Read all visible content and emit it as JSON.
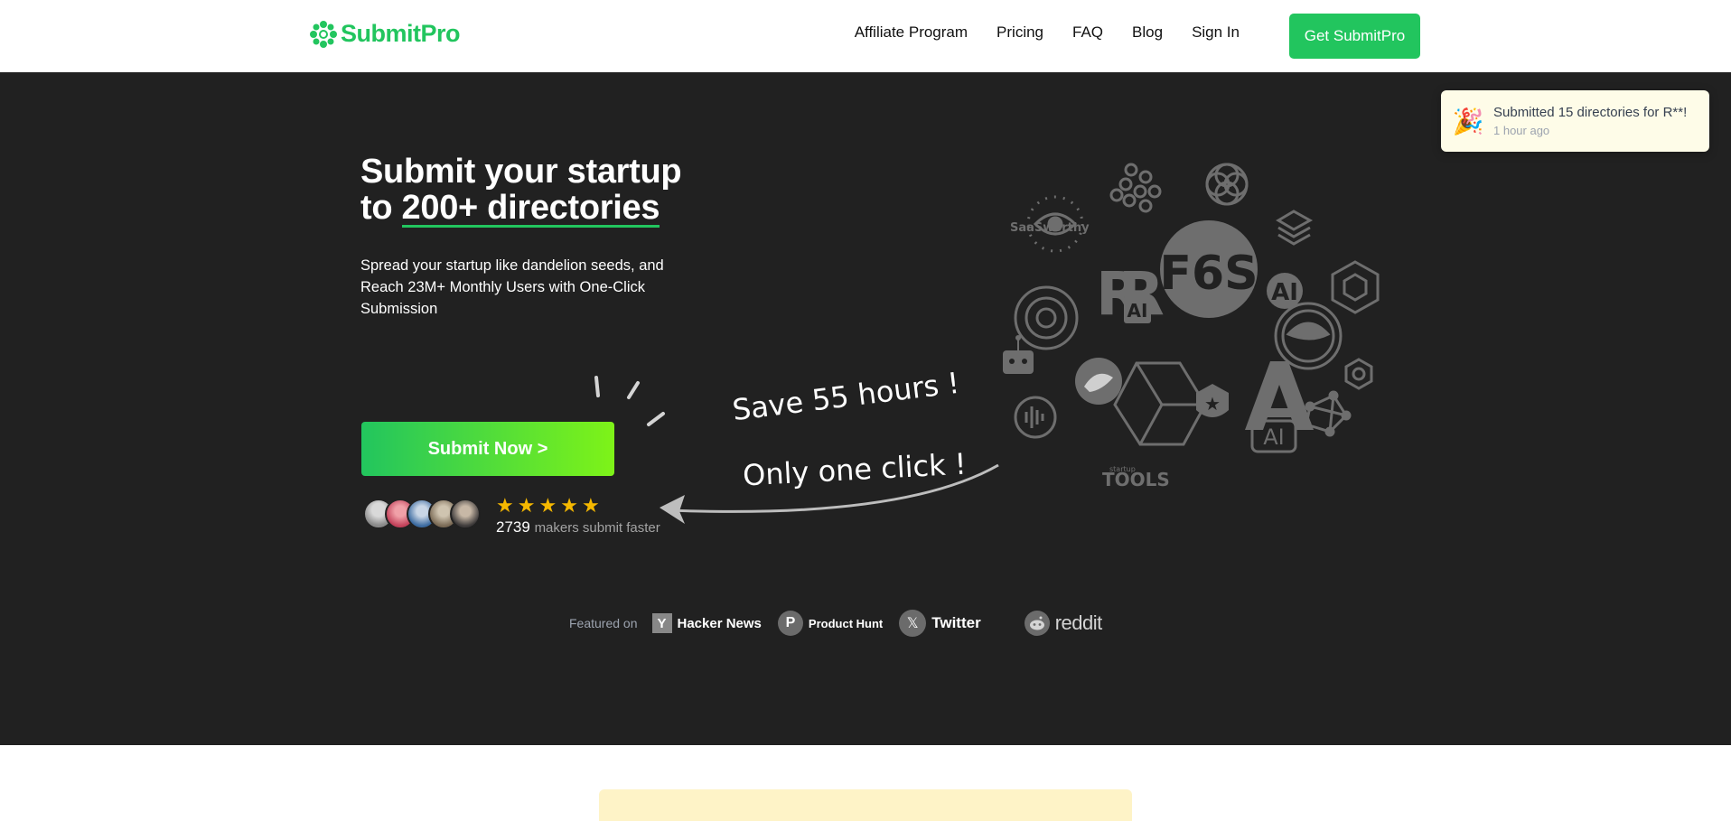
{
  "nav": {
    "logo_text": "SubmitPro",
    "links": [
      "Affiliate Program",
      "Pricing",
      "FAQ",
      "Blog",
      "Sign In"
    ],
    "cta_label": "Get SubmitPro"
  },
  "hero": {
    "headline_line1": "Submit your startup",
    "headline_prefix": "to ",
    "headline_highlight": "200+ directories",
    "subtext": "Spread your startup like dandelion seeds, and Reach 23M+ Monthly Users with One-Click Submission",
    "submit_button": "Submit Now >",
    "rating_stars": 5,
    "makers_count": "2739",
    "makers_text": "makers submit faster",
    "annotation_1": "Save 55 hours !",
    "annotation_2": "Only one click !"
  },
  "featured": {
    "label": "Featured on",
    "items": [
      {
        "name": "Hacker News",
        "icon": "hacker-news-icon",
        "glyph": "Y"
      },
      {
        "name": "Product Hunt",
        "icon": "product-hunt-icon",
        "glyph": "P"
      },
      {
        "name": "Twitter",
        "icon": "x-twitter-icon",
        "glyph": "𝕏"
      },
      {
        "name": "reddit",
        "icon": "reddit-icon",
        "glyph": ""
      }
    ]
  },
  "cluster_labels": {
    "saasworthy": "SaaSworthy",
    "f6s": "F6S",
    "ai1": "AI",
    "ai2": "AI",
    "ai3": "AI",
    "startup_tools": "TOOLS",
    "startup_small": "startup"
  },
  "toast": {
    "icon": "party-popper-icon",
    "title": "Submitted 15 directories for R**!",
    "time": "1 hour ago"
  },
  "colors": {
    "brand_green": "#22c55e",
    "hero_bg": "#212121",
    "gradient_end": "#7ef318",
    "star": "#f5b800"
  }
}
